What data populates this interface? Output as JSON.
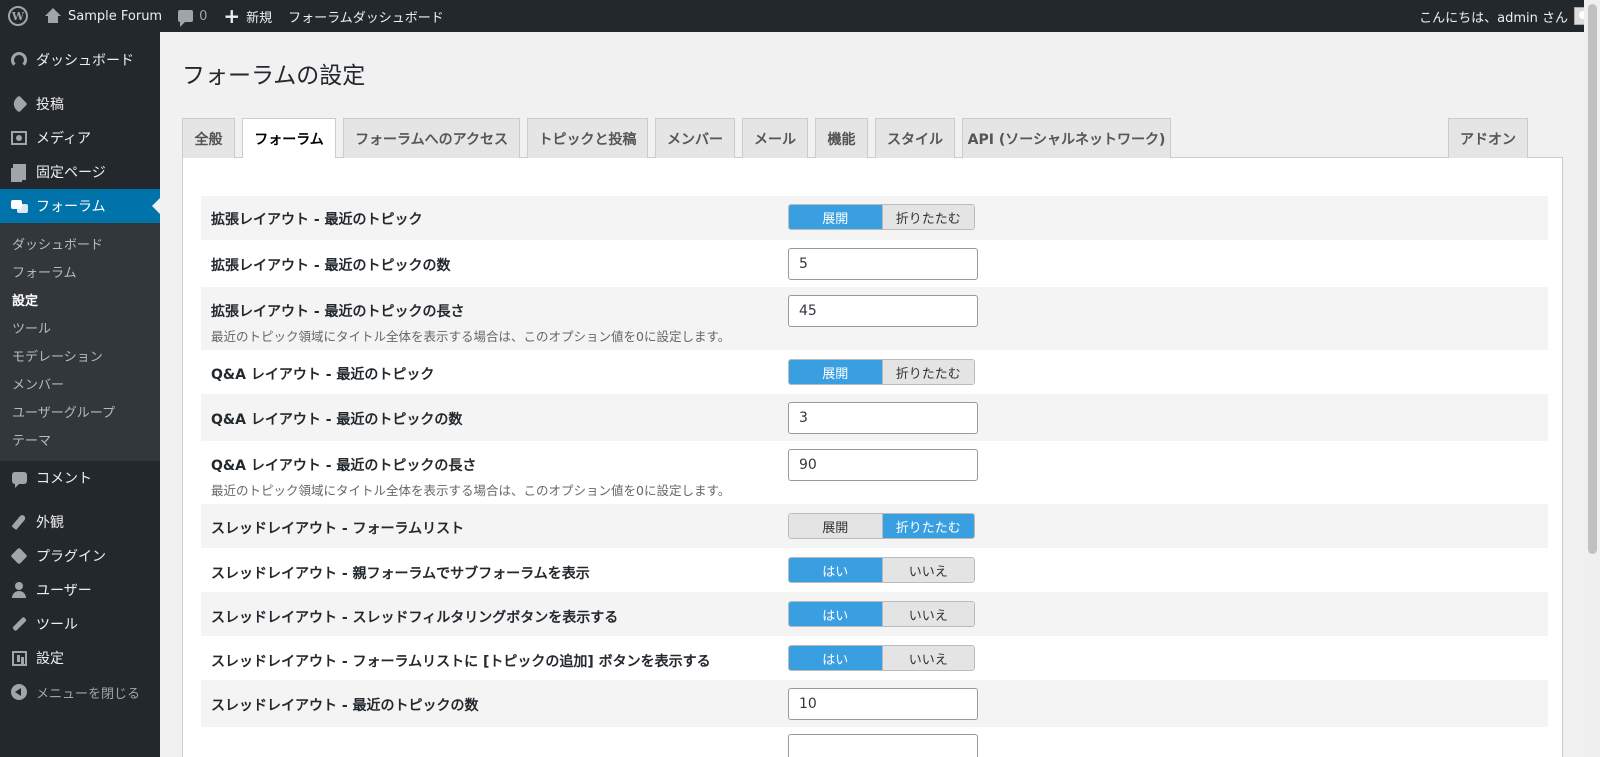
{
  "adminbar": {
    "site_name": "Sample Forum",
    "comments_count": "0",
    "new_label": "新規",
    "dashboard_link": "フォーラムダッシュボード",
    "greeting": "こんにちは、admin さん"
  },
  "sidebar": {
    "dashboard": "ダッシュボード",
    "posts": "投稿",
    "media": "メディア",
    "pages": "固定ページ",
    "forums": "フォーラム",
    "submenu": [
      "ダッシュボード",
      "フォーラム",
      "設定",
      "ツール",
      "モデレーション",
      "メンバー",
      "ユーザーグループ",
      "テーマ"
    ],
    "comments": "コメント",
    "appearance": "外観",
    "plugins": "プラグイン",
    "users": "ユーザー",
    "tools": "ツール",
    "settings": "設定",
    "collapse": "メニューを閉じる"
  },
  "page": {
    "title": "フォーラムの設定"
  },
  "tabs": [
    "全般",
    "フォーラム",
    "フォーラムへのアクセス",
    "トピックと投稿",
    "メンバー",
    "メール",
    "機能",
    "スタイル",
    "API (ソーシャルネットワーク)",
    "アドオン"
  ],
  "settings": [
    {
      "label": "拡張レイアウト - 最近のトピック",
      "type": "toggle",
      "options": [
        "展開",
        "折りたたむ"
      ],
      "selected": 0
    },
    {
      "label": "拡張レイアウト - 最近のトピックの数",
      "type": "input",
      "value": "5"
    },
    {
      "label": "拡張レイアウト - 最近のトピックの長さ",
      "type": "input",
      "value": "45",
      "desc": "最近のトピック領域にタイトル全体を表示する場合は、このオプション値を0に設定します。"
    },
    {
      "label": "Q&A レイアウト - 最近のトピック",
      "type": "toggle",
      "options": [
        "展開",
        "折りたたむ"
      ],
      "selected": 0
    },
    {
      "label": "Q&A レイアウト - 最近のトピックの数",
      "type": "input",
      "value": "3"
    },
    {
      "label": "Q&A レイアウト - 最近のトピックの長さ",
      "type": "input",
      "value": "90",
      "desc": "最近のトピック領域にタイトル全体を表示する場合は、このオプション値を0に設定します。"
    },
    {
      "label": "スレッドレイアウト - フォーラムリスト",
      "type": "toggle",
      "options": [
        "展開",
        "折りたたむ"
      ],
      "selected": 1
    },
    {
      "label": "スレッドレイアウト - 親フォーラムでサブフォーラムを表示",
      "type": "toggle",
      "options": [
        "はい",
        "いいえ"
      ],
      "selected": 0
    },
    {
      "label": "スレッドレイアウト - スレッドフィルタリングボタンを表示する",
      "type": "toggle",
      "options": [
        "はい",
        "いいえ"
      ],
      "selected": 0
    },
    {
      "label": "スレッドレイアウト - フォーラムリストに [トピックの追加] ボタンを表示する",
      "type": "toggle",
      "options": [
        "はい",
        "いいえ"
      ],
      "selected": 0
    },
    {
      "label": "スレッドレイアウト - 最近のトピックの数",
      "type": "input",
      "value": "10"
    }
  ],
  "colors": {
    "adminbar_bg": "#23282d",
    "sidebar_current": "#0073aa",
    "toggle_on": "#3a9fe0"
  }
}
